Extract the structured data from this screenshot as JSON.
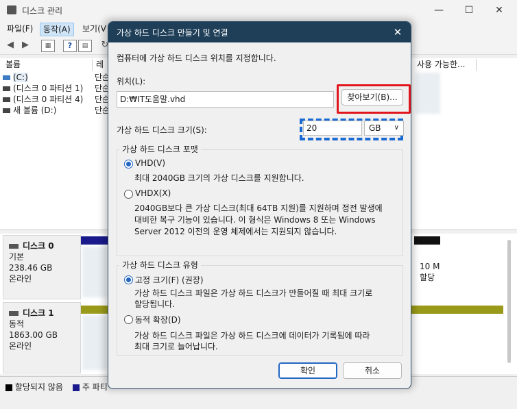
{
  "window": {
    "title": "디스크 관리",
    "minimize_icon": "minimize-icon",
    "maximize_icon": "maximize-icon",
    "close_icon": "close-icon"
  },
  "menu": {
    "items": [
      "파일(F)",
      "동작(A)",
      "보기(V"
    ],
    "active_index": 1
  },
  "volume_table": {
    "headers": [
      "볼륨",
      "레",
      "사용 가능한..."
    ],
    "rows": [
      {
        "name": "(C:)",
        "type": "단순"
      },
      {
        "name": "(디스크 0 파티션 1)",
        "type": "단순"
      },
      {
        "name": "(디스크 0 파티션 4)",
        "type": "단순"
      },
      {
        "name": "새 볼륨 (D:)",
        "type": "단순"
      }
    ]
  },
  "disks": [
    {
      "name": "디스크 0",
      "type": "기본",
      "size": "238.46 GB",
      "status": "온라인",
      "right_partition": "10 M",
      "right_status": "할당"
    },
    {
      "name": "디스크 1",
      "type": "동적",
      "size": "1863.00 GB",
      "status": "온라인"
    }
  ],
  "legend": {
    "unallocated": "할당되지 않음",
    "primary": "주 파티",
    "colors": {
      "unallocated": "#000000",
      "primary": "#1a1a8c"
    }
  },
  "dialog": {
    "title": "가상 하드 디스크 만들기 및 연결",
    "instruction": "컴퓨터에 가상 하드 디스크 위치를 지정합니다.",
    "location_label": "위치(L):",
    "location_value": "D:₩IT도움말.vhd",
    "browse_button": "찾아보기(B)...",
    "size_label": "가상 하드 디스크 크기(S):",
    "size_value": "20",
    "size_unit": "GB",
    "format_group": {
      "title": "가상 하드 디스크 포맷",
      "vhd_label": "VHD(V)",
      "vhd_desc": "최대 2040GB 크기의 가상 디스크를 지원합니다.",
      "vhdx_label": "VHDX(X)",
      "vhdx_desc_lines": [
        "2040GB보다 큰 가상 디스크(최대 64TB 지원)를 지원하며 정전 발생에",
        "대비한 복구 기능이 있습니다. 이 형식은 Windows 8 또는 Windows",
        "Server 2012 이전의 운영 체제에서는 지원되지 않습니다."
      ],
      "selected": "VHD(V)"
    },
    "type_group": {
      "title": "가상 하드 디스크 유형",
      "fixed_label": "고정 크기(F) (권장)",
      "fixed_desc_lines": [
        "가상 하드 디스크 파일은 가상 하드 디스크가 만들어질 때 최대 크기로",
        "할당됩니다."
      ],
      "dynamic_label": "동적 확장(D)",
      "dynamic_desc_lines": [
        "가상 하드 디스크 파일은 가상 하드 디스크에 데이터가 기록됨에 따라",
        "최대 크기로 늘어납니다."
      ],
      "selected": "고정 크기(F) (권장)"
    },
    "ok_button": "확인",
    "cancel_button": "취소"
  }
}
